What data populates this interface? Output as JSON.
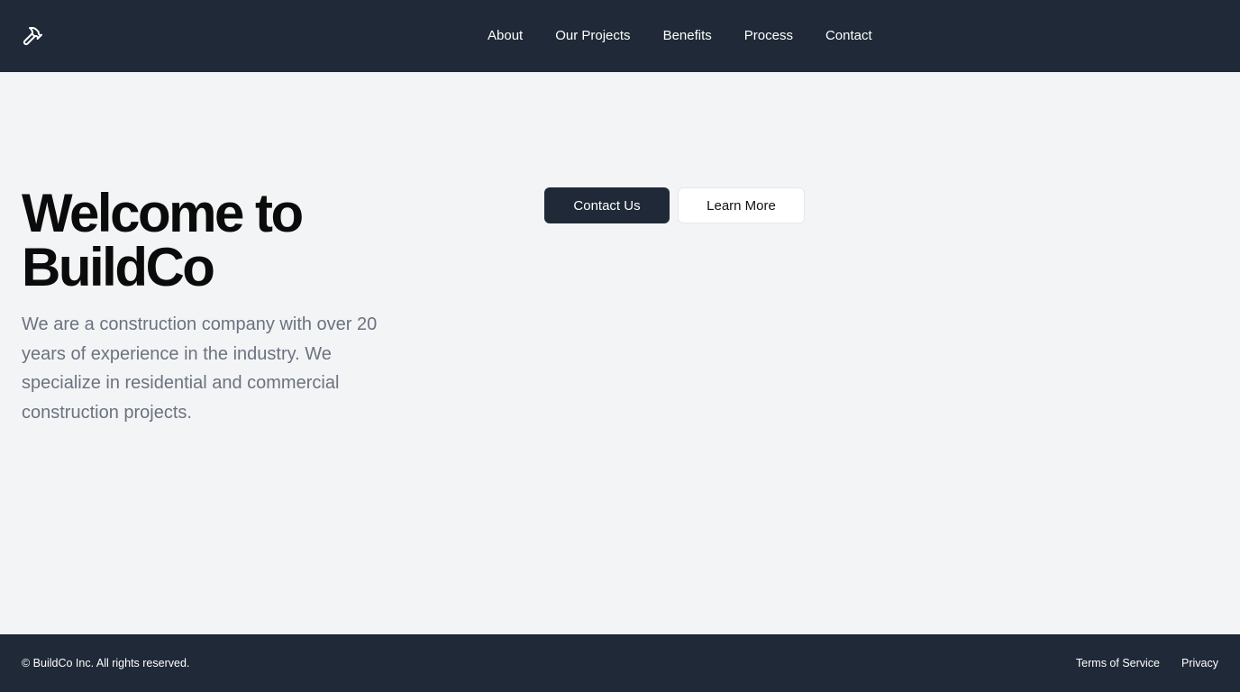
{
  "header": {
    "logo_icon": "hammer-icon",
    "nav": [
      {
        "label": "About"
      },
      {
        "label": "Our Projects"
      },
      {
        "label": "Benefits"
      },
      {
        "label": "Process"
      },
      {
        "label": "Contact"
      }
    ]
  },
  "hero": {
    "title": "Welcome to BuildCo",
    "description": "We are a construction company with over 20 years of experience in the industry. We specialize in residential and commercial construction projects.",
    "primary_button": "Contact Us",
    "secondary_button": "Learn More"
  },
  "footer": {
    "copyright": "© BuildCo Inc. All rights reserved.",
    "links": [
      {
        "label": "Terms of Service"
      },
      {
        "label": "Privacy"
      }
    ]
  },
  "colors": {
    "header_bg": "#1f2937",
    "page_bg": "#f3f4f6",
    "text_muted": "#6b7280",
    "primary_button": "#1f2937"
  }
}
